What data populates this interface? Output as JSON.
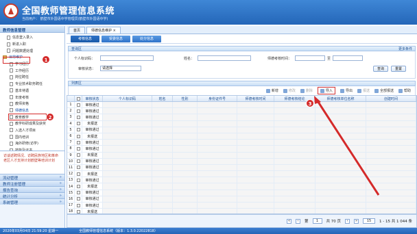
{
  "app": {
    "title": "全国教师管理信息系统",
    "user": "当前用户：  鹤壁市外国语中学管理员(鹤壁市外国语中学)"
  },
  "sidebar": {
    "header": "教师信息管理",
    "items": [
      "信息登入录入",
      "新进入职",
      "问题数据处理",
      "日常维护",
      "学习经历",
      "工作经历",
      "岗位聘任",
      "专业技术职务聘任",
      "基本待遇",
      "年度考核",
      "教师资格",
      "师德信息",
      "教育教学",
      "教学科研成果及获奖",
      "入选人才项目",
      "国内培训",
      "海外研修(访学)",
      "技能及证书",
      "交流轮岗(支教)"
    ],
    "notice": "访谈返聘情况、访聘民族地区和革命老区人才支持计划鹤壁等培训计划",
    "sections": [
      "流动管理",
      "教师注册管理",
      "报告查询",
      "统计分析",
      "系统管理"
    ]
  },
  "tabs": [
    "首页",
    "师德信息维护"
  ],
  "subtabs": [
    "考核信息",
    "受委信息",
    "处分信息"
  ],
  "search_panel": {
    "title": "查询区",
    "more": "更多条件",
    "id_label": "个人标识码：",
    "name_label": "姓名：",
    "time_label": "师德考核时间：",
    "time_sep": "至",
    "status_label": "审核状态：",
    "status_value": "请选择",
    "search_btn": "查询",
    "reset_btn": "重置"
  },
  "list": {
    "title": "列表区"
  },
  "toolbar": {
    "add": "新增",
    "edit": "修改",
    "delete": "删除",
    "import": "导入",
    "export": "导出",
    "report": "报送",
    "report_all": "全部报送",
    "help": "帮助"
  },
  "columns": [
    "",
    "",
    "审核状态",
    "个人标识码",
    "姓名",
    "性别",
    "身份证件号",
    "师德考核时间",
    "师德考核结论",
    "师德考核单位名称",
    "创建时间"
  ],
  "rows": [
    "审核通过",
    "审核通过",
    "审核通过",
    "未报送",
    "审核通过",
    "未报送",
    "审核通过",
    "审核通过",
    "未报送",
    "审核通过",
    "审核通过",
    "未报送",
    "审核通过",
    "未报送",
    "审核通过",
    "审核通过",
    "审核通过",
    "未报送"
  ],
  "pager": {
    "page_label": "第",
    "page_value": "1",
    "of_text": "共 70 页",
    "page_size": "15",
    "summary": "1 - 15  共 1 044 条"
  },
  "status": {
    "datetime": "2020年03月04日  21:59:20  星期一",
    "system": "全国教师管理信息系统（版本：1.3.0.22022818）"
  },
  "markers": [
    "1",
    "2",
    "3"
  ],
  "colors": {
    "banner": "#2466b8",
    "marker": "#d42a2a"
  }
}
